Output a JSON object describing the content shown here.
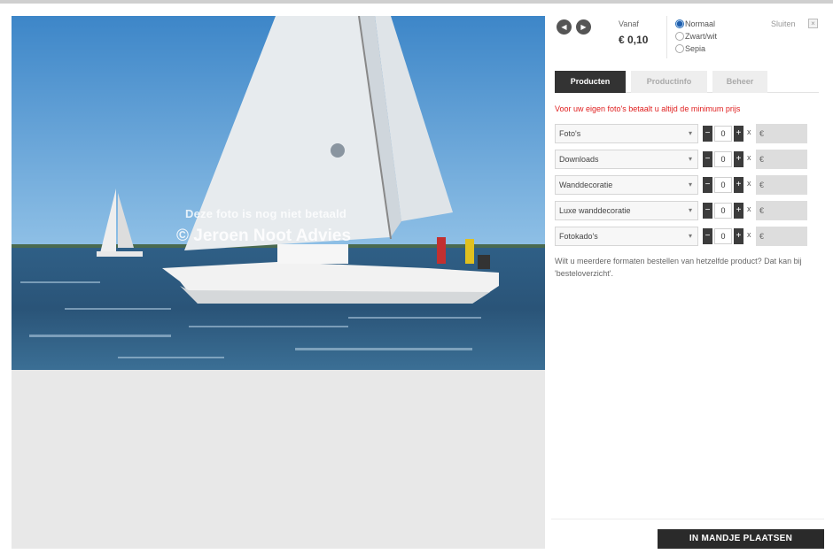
{
  "photo": {
    "watermark_line1": "Deze foto is nog niet betaald",
    "watermark_line2": "© Jeroen Noot Advies"
  },
  "nav": {
    "prev_icon": "chevron-left-icon",
    "next_icon": "chevron-right-icon"
  },
  "price": {
    "label": "Vanaf",
    "value": "€ 0,10"
  },
  "color_options": [
    {
      "label": "Normaal",
      "checked": true
    },
    {
      "label": "Zwart/wit",
      "checked": false
    },
    {
      "label": "Sepia",
      "checked": false
    }
  ],
  "close": {
    "label": "Sluiten"
  },
  "tabs": [
    {
      "label": "Producten",
      "active": true
    },
    {
      "label": "Productinfo",
      "active": false
    },
    {
      "label": "Beheer",
      "active": false
    }
  ],
  "notice": "Voor uw eigen foto's betaalt u altijd de minimum prijs",
  "products": [
    {
      "name": "Foto's",
      "qty": "0",
      "x": "x",
      "currency": "€"
    },
    {
      "name": "Downloads",
      "qty": "0",
      "x": "x",
      "currency": "€"
    },
    {
      "name": "Wanddecoratie",
      "qty": "0",
      "x": "x",
      "currency": "€"
    },
    {
      "name": "Luxe wanddecoratie",
      "qty": "0",
      "x": "x",
      "currency": "€"
    },
    {
      "name": "Fotokado's",
      "qty": "0",
      "x": "x",
      "currency": "€"
    }
  ],
  "qty_controls": {
    "minus": "−",
    "plus": "+"
  },
  "info_text": "Wilt u meerdere formaten bestellen van hetzelfde product? Dat kan bij 'besteloverzicht'.",
  "cart_button": "IN MANDJE PLAATSEN",
  "colors": {
    "accent_dark": "#333333",
    "notice_red": "#e02020",
    "radio_blue": "#1f5fae"
  }
}
